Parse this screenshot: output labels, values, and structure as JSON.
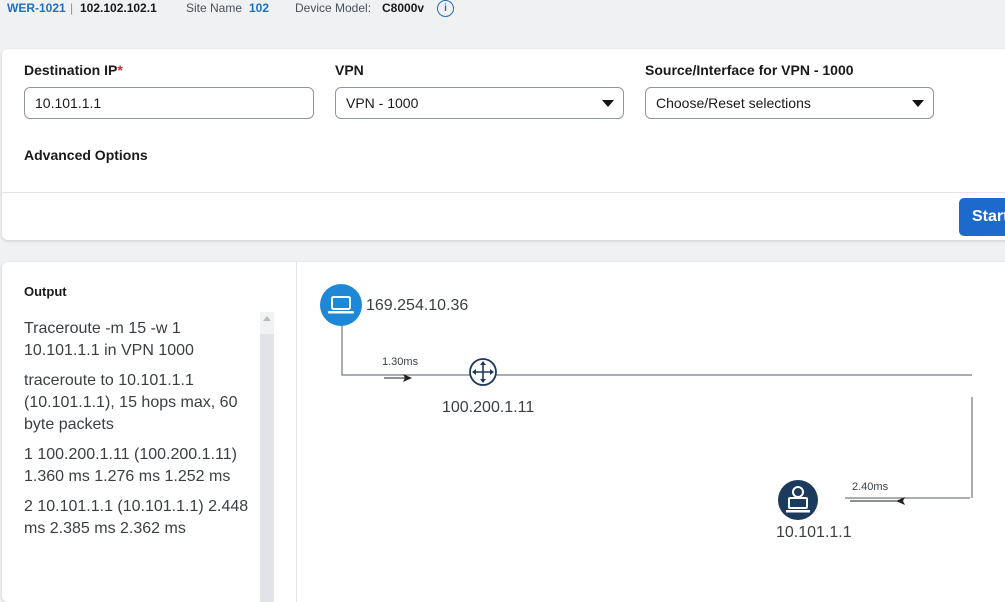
{
  "header": {
    "device_id": "WER-1021",
    "separator": "|",
    "system_ip": "102.102.102.1",
    "site_label": "Site Name",
    "site_value": "102",
    "model_label": "Device Model:",
    "model_value": "C8000v",
    "info_glyph": "i"
  },
  "form": {
    "destination_label": "Destination IP",
    "required_mark": "*",
    "destination_value": "10.101.1.1",
    "vpn_label": "VPN",
    "vpn_value": "VPN - 1000",
    "source_label": "Source/Interface for VPN - 1000",
    "source_value": "Choose/Reset selections",
    "advanced_label": "Advanced Options",
    "start_label": "Start"
  },
  "output": {
    "title": "Output",
    "lines": [
      "Traceroute -m 15 -w 1 10.101.1.1 in VPN 1000",
      "traceroute to 10.101.1.1 (10.101.1.1), 15 hops max, 60 byte packets",
      "1 100.200.1.11 (100.200.1.11) 1.360 ms 1.276 ms 1.252 ms",
      "2 10.101.1.1 (10.101.1.1) 2.448 ms 2.385 ms 2.362 ms"
    ]
  },
  "diagram": {
    "source_ip": "169.254.10.36",
    "hop1_ip": "100.200.1.11",
    "hop1_latency": "1.30ms",
    "dest_ip": "10.101.1.1",
    "dest_latency": "2.40ms"
  },
  "colors": {
    "accent": "#1f6fc1",
    "button": "#1d69cc",
    "node_source": "#1f88d6",
    "node_dest": "#1b3a5c"
  },
  "icons": [
    "info-icon",
    "laptop-icon",
    "router-icon",
    "host-icon",
    "chevron-down-icon"
  ]
}
